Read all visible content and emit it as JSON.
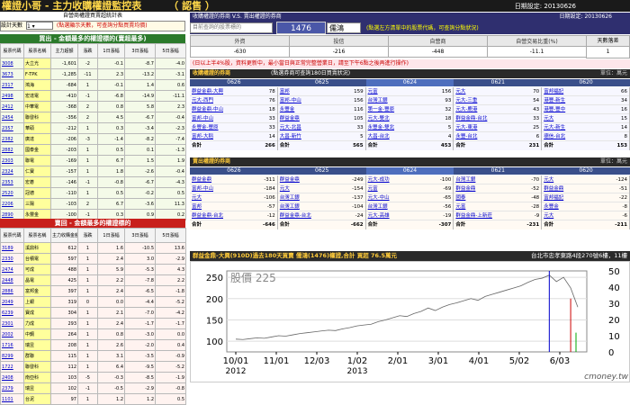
{
  "app": {
    "title": "權證小哥 - 主力收購權證監控表",
    "subtitle": "（ 認售 ）",
    "date_label": "日期設定:",
    "date": "20130626"
  },
  "left": {
    "subtitle": "自營商權證買賣超統計表",
    "control": {
      "label": "設計天數",
      "value": "1",
      "note": "(點選顯示天數，可查詢分點買賣均價)"
    },
    "buy": {
      "header": "買出 - 金額最多的權證標的(賣超最多)",
      "columns": [
        "股票代碼",
        "股票名稱",
        "主力超額",
        "漲跌",
        "1日漲幅",
        "3日漲幅",
        "5日漲幅"
      ],
      "rows": [
        [
          "3008",
          "大立光",
          "-1,601",
          "-2",
          "-0.1",
          "-8.7",
          "-4.0"
        ],
        [
          "3673",
          "F-TPK",
          "-1,285",
          "-11",
          "2.3",
          "-13.2",
          "-3.1"
        ],
        [
          "2317",
          "鴻海",
          "-684",
          "1",
          "-0.1",
          "1.4",
          "0.6"
        ],
        [
          "2498",
          "宏達電",
          "-410",
          "-1",
          "-6.8",
          "-14.9",
          "-11.1"
        ],
        [
          "2412",
          "中華電",
          "-368",
          "2",
          "0.8",
          "5.8",
          "2.3"
        ],
        [
          "2454",
          "聯發科",
          "-356",
          "2",
          "4.5",
          "-6.7",
          "-0.4"
        ],
        [
          "2357",
          "華碩",
          "-212",
          "1",
          "0.3",
          "-3.4",
          "-2.3"
        ],
        [
          "2382",
          "廣達",
          "-206",
          "-3",
          "-1.4",
          "-8.2",
          "-7.4"
        ],
        [
          "2882",
          "國泰金",
          "-203",
          "1",
          "0.5",
          "0.1",
          "-1.3"
        ],
        [
          "2303",
          "聯電",
          "-169",
          "1",
          "6.7",
          "1.5",
          "1.9"
        ],
        [
          "2324",
          "仁寶",
          "-157",
          "1",
          "1.8",
          "-2.6",
          "-0.4"
        ],
        [
          "2353",
          "宏碁",
          "-146",
          "-1",
          "-0.8",
          "-6.7",
          "-4.3"
        ],
        [
          "2520",
          "冠德",
          "-110",
          "1",
          "0.5",
          "-0.2",
          "0.5"
        ],
        [
          "2206",
          "三陽",
          "-103",
          "2",
          "6.7",
          "-3.6",
          "11.3"
        ],
        [
          "2890",
          "永豐金",
          "-100",
          "-1",
          "0.3",
          "0.9",
          "0.2"
        ]
      ]
    },
    "sell": {
      "header": "賣回 - 金額最多的權證標的",
      "columns": [
        "股票代碼",
        "股票名稱",
        "主力收購金額(萬元)",
        "漲跌",
        "1日漲幅",
        "3日漲幅",
        "5日漲幅"
      ],
      "rows": [
        [
          "3189",
          "溪鼎科",
          "612",
          "1",
          "1.6",
          "-10.5",
          "13.6"
        ],
        [
          "2330",
          "台積電",
          "597",
          "1",
          "2.4",
          "3.0",
          "-2.9"
        ],
        [
          "2474",
          "可成",
          "488",
          "1",
          "5.9",
          "-5.3",
          "4.3"
        ],
        [
          "2448",
          "晶電",
          "425",
          "1",
          "2.2",
          "-7.8",
          "2.2"
        ],
        [
          "2886",
          "富邦金",
          "397",
          "1",
          "2.4",
          "-6.5",
          "-1.8"
        ],
        [
          "2049",
          "上銀",
          "319",
          "0",
          "0.0",
          "-4.4",
          "-5.2"
        ],
        [
          "6239",
          "寶成",
          "304",
          "1",
          "2.1",
          "-7.0",
          "-4.2"
        ],
        [
          "2301",
          "力成",
          "293",
          "1",
          "2.4",
          "-1.7",
          "-1.7"
        ],
        [
          "2002",
          "中鋼",
          "264",
          "1",
          "0.8",
          "-3.0",
          "0.0"
        ],
        [
          "1716",
          "瑞昱",
          "208",
          "1",
          "2.6",
          "-2.0",
          "0.4"
        ],
        [
          "8299",
          "群聯",
          "115",
          "1",
          "3.1",
          "-3.5",
          "-0.9"
        ],
        [
          "1722",
          "聯發科",
          "112",
          "1",
          "6.4",
          "-9.5",
          "-5.2"
        ],
        [
          "2408",
          "南亞科",
          "103",
          "-5",
          "-0.3",
          "-8.5",
          "-1.9"
        ],
        [
          "2379",
          "瑞昱",
          "102",
          "-1",
          "-0.5",
          "-2.9",
          "-0.8"
        ],
        [
          "1101",
          "台泥",
          "97",
          "1",
          "1.2",
          "1.2",
          "0.5"
        ]
      ]
    }
  },
  "right": {
    "top_title": "收購權證的券商 V.S. 賣出權證的券商",
    "selector": {
      "label": "目前查詢的股票標的",
      "code": "1476",
      "name": "儒鴻",
      "hint": "(點選左方清單中的股票代碼，可查詢分點狀況)"
    },
    "summary": {
      "headers": [
        "外資",
        "投信",
        "自營商",
        "自營交易比重(%)"
      ],
      "values": [
        "-630",
        "-216",
        "-448",
        "-11.1"
      ],
      "days_label": "天數落差",
      "days_value": "1"
    },
    "notice": "(日以上半4%股，資料更新中，最小當日與正常完整營業日，請至下午6點之後再進行操作)",
    "buy_section": {
      "title": "收購權證的券商",
      "meta": "(點選券商可查詢180日買賣狀況)",
      "unit": "單位：萬元",
      "days": [
        "0626",
        "0625",
        "0624",
        "0621",
        "0620"
      ],
      "cols": [
        {
          "rows": [
            [
              "群益金鼎-大興",
              "78"
            ],
            [
              "元大-西門",
              "76"
            ],
            [
              "群益金鼎-中山",
              "18"
            ],
            [
              "富邦-中山",
              "33"
            ],
            [
              "永豐金-豐原",
              "33"
            ],
            [
              "富邦-大稻",
              "14"
            ]
          ],
          "total": "266"
        },
        {
          "rows": [
            [
              "富邦",
              "159"
            ],
            [
              "富邦-中山",
              "156"
            ],
            [
              "永豐金",
              "116"
            ],
            [
              "群益金鼎",
              "105"
            ],
            [
              "元大-北昌",
              "33"
            ],
            [
              "大昌-新竹",
              "5"
            ]
          ],
          "total": "565"
        },
        {
          "rows": [
            [
              "元富",
              "156"
            ],
            [
              "台灣工銀",
              "93"
            ],
            [
              "第一金-豐原",
              "32"
            ],
            [
              "元大-雙北",
              "18"
            ],
            [
              "永豐金-雙北",
              "5"
            ],
            [
              "大昌-台北",
              "4"
            ]
          ],
          "total": "453"
        },
        {
          "rows": [
            [
              "元大",
              "70"
            ],
            [
              "元大-三重",
              "54"
            ],
            [
              "元大-鹿港",
              "43"
            ],
            [
              "群益金鼎-台北",
              "33"
            ],
            [
              "元大-東港",
              "25"
            ],
            [
              "永豐-台北",
              "6"
            ]
          ],
          "total": "231"
        },
        {
          "rows": [
            [
              "富邦福記",
              "66"
            ],
            [
              "港豐-新生",
              "34"
            ],
            [
              "港豐-豐中",
              "16"
            ],
            [
              "元大",
              "15"
            ],
            [
              "元大-新生",
              "14"
            ],
            [
              "德信-台北",
              "8"
            ]
          ],
          "total": "153"
        }
      ]
    },
    "sell_section": {
      "title": "賣出權證的券商",
      "unit": "單位：萬元",
      "days": [
        "0626",
        "0625",
        "0624",
        "0621",
        "0620"
      ],
      "cols": [
        {
          "rows": [
            [
              "群益金鼎",
              "-311"
            ],
            [
              "富邦-中山",
              "-184"
            ],
            [
              "元大",
              "-106"
            ],
            [
              "富邦",
              "-57"
            ],
            [
              "群益金鼎-台北",
              "-12"
            ]
          ],
          "total": "-646"
        },
        {
          "rows": [
            [
              "群益金鼎",
              "-249"
            ],
            [
              "元大",
              "-154"
            ],
            [
              "台灣工銀",
              "-137"
            ],
            [
              "台灣工銀",
              "-104"
            ],
            [
              "群益金鼎-台北",
              "-24"
            ]
          ],
          "total": "-662"
        },
        {
          "rows": [
            [
              "元大-成功",
              "-100"
            ],
            [
              "元富",
              "-69"
            ],
            [
              "元大-中山",
              "-65"
            ],
            [
              "台灣工銀",
              "-56"
            ],
            [
              "元大-高雄",
              "-19"
            ]
          ],
          "total": "-307"
        },
        {
          "rows": [
            [
              "台灣工銀",
              "-70"
            ],
            [
              "群益金鼎",
              "-52"
            ],
            [
              "國泰",
              "-48"
            ],
            [
              "元富",
              "-28"
            ],
            [
              "群益金鼎-上新莊",
              "-9"
            ]
          ],
          "total": "-231"
        },
        {
          "rows": [
            [
              "元大",
              "-124"
            ],
            [
              "群益金鼎",
              "-51"
            ],
            [
              "富邦福記",
              "-22"
            ],
            [
              "永豐金",
              "-8"
            ],
            [
              "元大",
              "-6"
            ]
          ],
          "total": "-211"
        }
      ]
    },
    "chart": {
      "header": "群益金鼎-大興(910D)過去180天買賣 儒鴻(1476)權證,合計 買超 76.5萬元",
      "address": "台北市忠孝東路4段270號6樓，11樓"
    }
  },
  "chart_data": {
    "type": "line",
    "title": "股價 225",
    "x_ticks": [
      "10/01",
      "11/01",
      "12/03",
      "1/02",
      "2/01",
      "3/01",
      "4/01",
      "5/02",
      "6/03"
    ],
    "x_years": [
      "2012",
      "2013"
    ],
    "y_left_ticks": [
      100,
      150,
      200,
      250
    ],
    "y_right_ticks": [
      0,
      10,
      20,
      30,
      40,
      50
    ],
    "ylim": [
      75,
      265
    ],
    "series": [
      {
        "name": "股價",
        "values": [
          105,
          104,
          106,
          108,
          107,
          110,
          113,
          112,
          115,
          118,
          120,
          122,
          124,
          126,
          125,
          129,
          132,
          136,
          138,
          140,
          146,
          150,
          155,
          160,
          158,
          165,
          170,
          178,
          172,
          180,
          186,
          190,
          195,
          200,
          196,
          205,
          210,
          215,
          220,
          225,
          230,
          238,
          245,
          248,
          255,
          240,
          250,
          225,
          180
        ]
      }
    ],
    "markers": {
      "blue_index": 44
    }
  },
  "watermark": "cmoney.tw"
}
